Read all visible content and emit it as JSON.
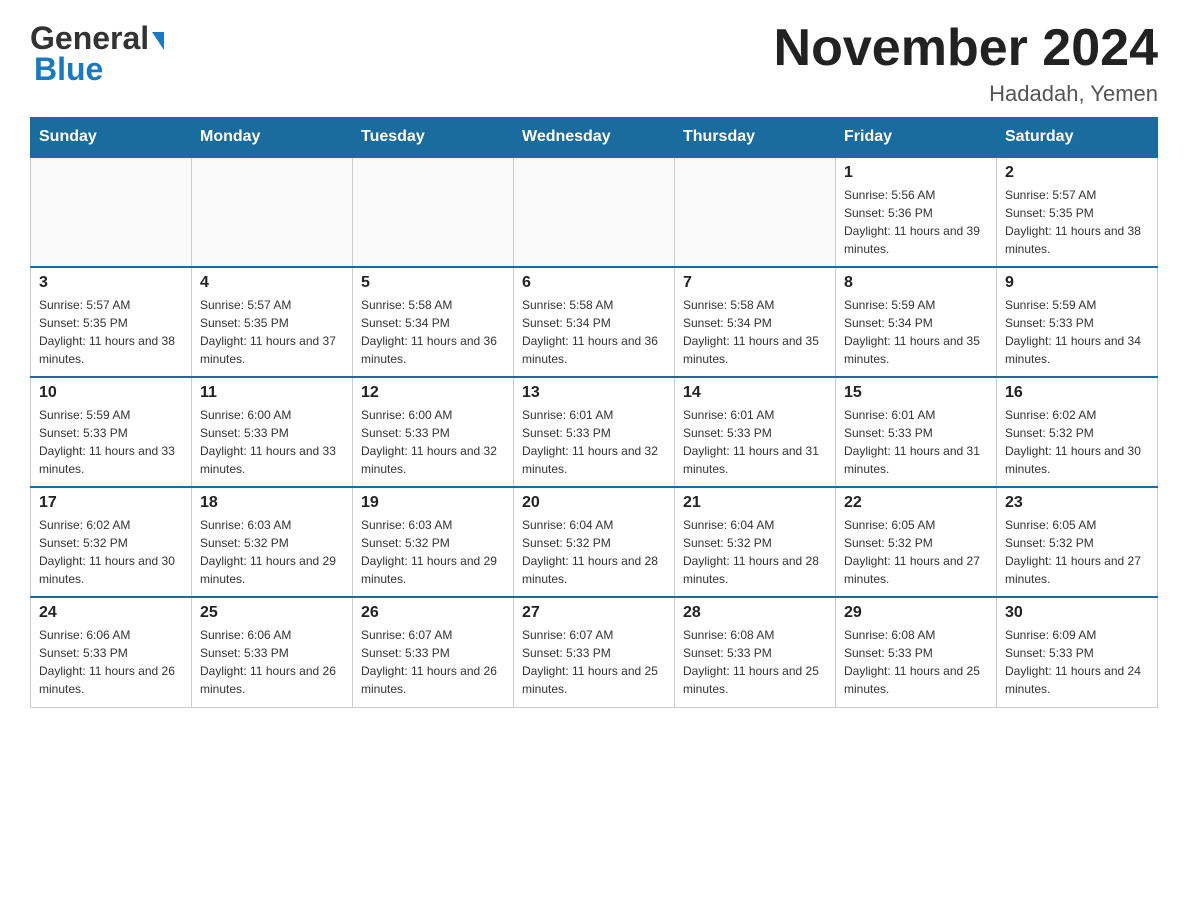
{
  "header": {
    "logo": {
      "general": "General",
      "blue": "Blue",
      "triangle_color": "#1a7abf"
    },
    "month_title": "November 2024",
    "location": "Hadadah, Yemen"
  },
  "weekdays": [
    "Sunday",
    "Monday",
    "Tuesday",
    "Wednesday",
    "Thursday",
    "Friday",
    "Saturday"
  ],
  "weeks": [
    [
      {
        "day": "",
        "info": ""
      },
      {
        "day": "",
        "info": ""
      },
      {
        "day": "",
        "info": ""
      },
      {
        "day": "",
        "info": ""
      },
      {
        "day": "",
        "info": ""
      },
      {
        "day": "1",
        "info": "Sunrise: 5:56 AM\nSunset: 5:36 PM\nDaylight: 11 hours and 39 minutes."
      },
      {
        "day": "2",
        "info": "Sunrise: 5:57 AM\nSunset: 5:35 PM\nDaylight: 11 hours and 38 minutes."
      }
    ],
    [
      {
        "day": "3",
        "info": "Sunrise: 5:57 AM\nSunset: 5:35 PM\nDaylight: 11 hours and 38 minutes."
      },
      {
        "day": "4",
        "info": "Sunrise: 5:57 AM\nSunset: 5:35 PM\nDaylight: 11 hours and 37 minutes."
      },
      {
        "day": "5",
        "info": "Sunrise: 5:58 AM\nSunset: 5:34 PM\nDaylight: 11 hours and 36 minutes."
      },
      {
        "day": "6",
        "info": "Sunrise: 5:58 AM\nSunset: 5:34 PM\nDaylight: 11 hours and 36 minutes."
      },
      {
        "day": "7",
        "info": "Sunrise: 5:58 AM\nSunset: 5:34 PM\nDaylight: 11 hours and 35 minutes."
      },
      {
        "day": "8",
        "info": "Sunrise: 5:59 AM\nSunset: 5:34 PM\nDaylight: 11 hours and 35 minutes."
      },
      {
        "day": "9",
        "info": "Sunrise: 5:59 AM\nSunset: 5:33 PM\nDaylight: 11 hours and 34 minutes."
      }
    ],
    [
      {
        "day": "10",
        "info": "Sunrise: 5:59 AM\nSunset: 5:33 PM\nDaylight: 11 hours and 33 minutes."
      },
      {
        "day": "11",
        "info": "Sunrise: 6:00 AM\nSunset: 5:33 PM\nDaylight: 11 hours and 33 minutes."
      },
      {
        "day": "12",
        "info": "Sunrise: 6:00 AM\nSunset: 5:33 PM\nDaylight: 11 hours and 32 minutes."
      },
      {
        "day": "13",
        "info": "Sunrise: 6:01 AM\nSunset: 5:33 PM\nDaylight: 11 hours and 32 minutes."
      },
      {
        "day": "14",
        "info": "Sunrise: 6:01 AM\nSunset: 5:33 PM\nDaylight: 11 hours and 31 minutes."
      },
      {
        "day": "15",
        "info": "Sunrise: 6:01 AM\nSunset: 5:33 PM\nDaylight: 11 hours and 31 minutes."
      },
      {
        "day": "16",
        "info": "Sunrise: 6:02 AM\nSunset: 5:32 PM\nDaylight: 11 hours and 30 minutes."
      }
    ],
    [
      {
        "day": "17",
        "info": "Sunrise: 6:02 AM\nSunset: 5:32 PM\nDaylight: 11 hours and 30 minutes."
      },
      {
        "day": "18",
        "info": "Sunrise: 6:03 AM\nSunset: 5:32 PM\nDaylight: 11 hours and 29 minutes."
      },
      {
        "day": "19",
        "info": "Sunrise: 6:03 AM\nSunset: 5:32 PM\nDaylight: 11 hours and 29 minutes."
      },
      {
        "day": "20",
        "info": "Sunrise: 6:04 AM\nSunset: 5:32 PM\nDaylight: 11 hours and 28 minutes."
      },
      {
        "day": "21",
        "info": "Sunrise: 6:04 AM\nSunset: 5:32 PM\nDaylight: 11 hours and 28 minutes."
      },
      {
        "day": "22",
        "info": "Sunrise: 6:05 AM\nSunset: 5:32 PM\nDaylight: 11 hours and 27 minutes."
      },
      {
        "day": "23",
        "info": "Sunrise: 6:05 AM\nSunset: 5:32 PM\nDaylight: 11 hours and 27 minutes."
      }
    ],
    [
      {
        "day": "24",
        "info": "Sunrise: 6:06 AM\nSunset: 5:33 PM\nDaylight: 11 hours and 26 minutes."
      },
      {
        "day": "25",
        "info": "Sunrise: 6:06 AM\nSunset: 5:33 PM\nDaylight: 11 hours and 26 minutes."
      },
      {
        "day": "26",
        "info": "Sunrise: 6:07 AM\nSunset: 5:33 PM\nDaylight: 11 hours and 26 minutes."
      },
      {
        "day": "27",
        "info": "Sunrise: 6:07 AM\nSunset: 5:33 PM\nDaylight: 11 hours and 25 minutes."
      },
      {
        "day": "28",
        "info": "Sunrise: 6:08 AM\nSunset: 5:33 PM\nDaylight: 11 hours and 25 minutes."
      },
      {
        "day": "29",
        "info": "Sunrise: 6:08 AM\nSunset: 5:33 PM\nDaylight: 11 hours and 25 minutes."
      },
      {
        "day": "30",
        "info": "Sunrise: 6:09 AM\nSunset: 5:33 PM\nDaylight: 11 hours and 24 minutes."
      }
    ]
  ]
}
